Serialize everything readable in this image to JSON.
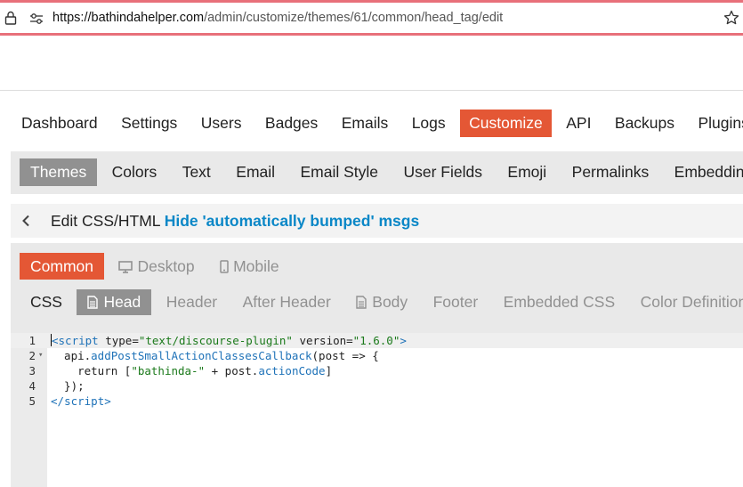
{
  "browser": {
    "url_host": "https://bathindahelper.com",
    "url_path": "/admin/customize/themes/61/common/head_tag/edit"
  },
  "main_nav": [
    {
      "label": "Dashboard",
      "active": false
    },
    {
      "label": "Settings",
      "active": false
    },
    {
      "label": "Users",
      "active": false
    },
    {
      "label": "Badges",
      "active": false
    },
    {
      "label": "Emails",
      "active": false
    },
    {
      "label": "Logs",
      "active": false
    },
    {
      "label": "Customize",
      "active": true
    },
    {
      "label": "API",
      "active": false
    },
    {
      "label": "Backups",
      "active": false
    },
    {
      "label": "Plugins",
      "active": false
    }
  ],
  "sub_nav": [
    {
      "label": "Themes",
      "active": true
    },
    {
      "label": "Colors",
      "active": false
    },
    {
      "label": "Text",
      "active": false
    },
    {
      "label": "Email",
      "active": false
    },
    {
      "label": "Email Style",
      "active": false
    },
    {
      "label": "User Fields",
      "active": false
    },
    {
      "label": "Emoji",
      "active": false
    },
    {
      "label": "Permalinks",
      "active": false
    },
    {
      "label": "Embedding",
      "active": false
    }
  ],
  "title": {
    "prefix": "Edit CSS/HTML",
    "theme_name": "Hide 'automatically bumped' msgs"
  },
  "targets": {
    "common": "Common",
    "desktop": "Desktop",
    "mobile": "Mobile"
  },
  "fields": {
    "css": "CSS",
    "head": "Head",
    "header": "Header",
    "after_header": "After Header",
    "body": "Body",
    "footer": "Footer",
    "embedded_css": "Embedded CSS",
    "color_definitions": "Color Definitions"
  },
  "editor": {
    "line_numbers": [
      "1",
      "2",
      "3",
      "4",
      "5"
    ],
    "l1": {
      "open": "<script",
      "attr1": " type=",
      "val1": "\"text/discourse-plugin\"",
      "attr2": " version=",
      "val2": "\"1.6.0\"",
      "close": ">"
    },
    "l2": {
      "indent": "  api.",
      "method": "addPostSmallActionClassesCallback",
      "rest": "(post => {"
    },
    "l3": {
      "indent": "    return [",
      "str": "\"bathinda-\"",
      "plus": " + post.",
      "prop": "actionCode",
      "end": "]"
    },
    "l4": {
      "text": "  });"
    },
    "l5": {
      "open": "</",
      "tag": "script",
      "close": ">"
    }
  },
  "colors": {
    "accent": "#e45735",
    "link": "#0a87c7",
    "tab_active_gray": "#919191"
  }
}
